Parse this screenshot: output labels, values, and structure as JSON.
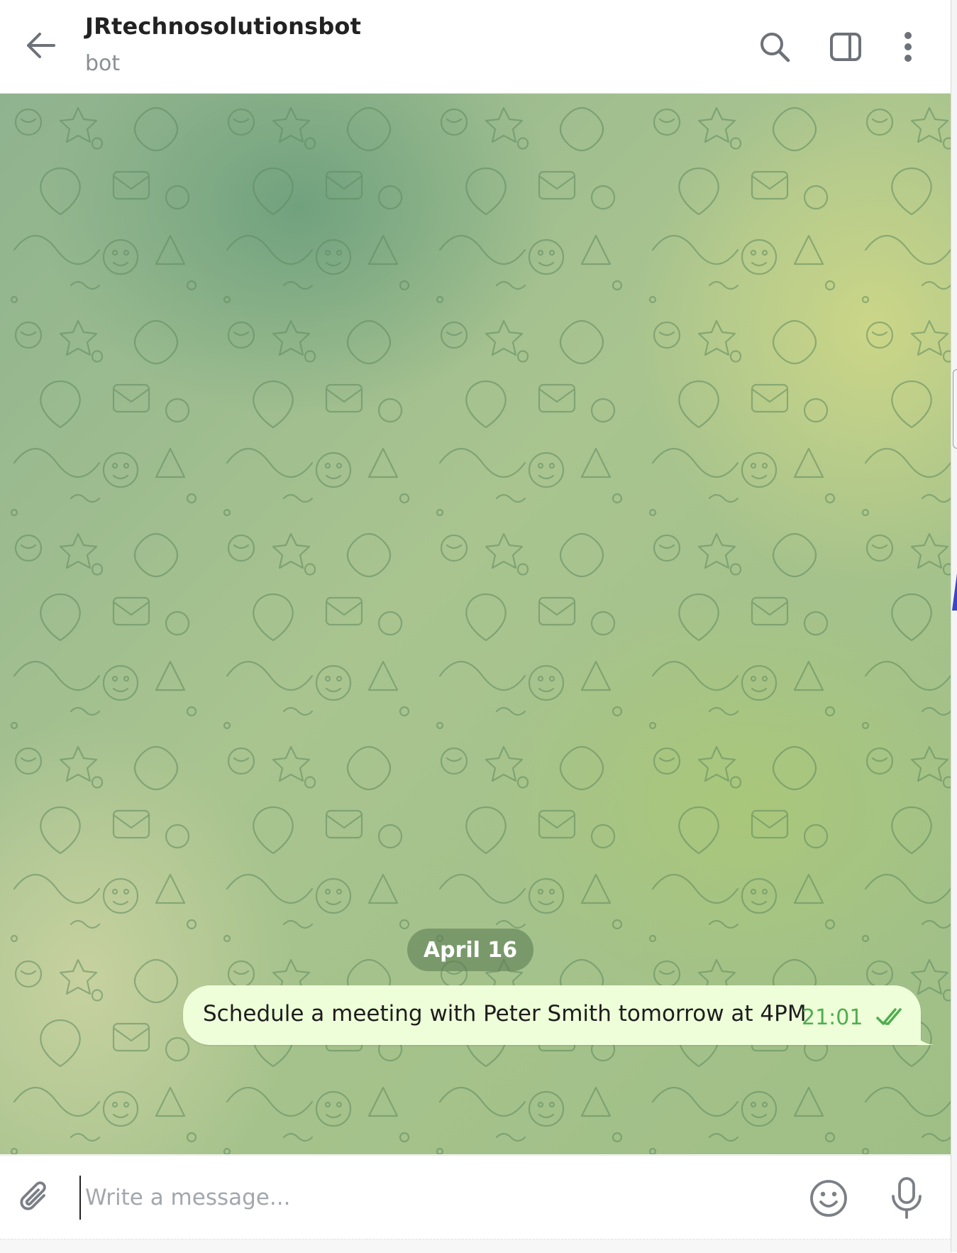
{
  "header": {
    "title": "JRtechnosolutionsbot",
    "subtitle": "bot",
    "icons": [
      "back-arrow-icon",
      "search-icon",
      "sidebar-toggle-icon",
      "more-vertical-icon"
    ]
  },
  "chat": {
    "date_label": "April 16",
    "messages": [
      {
        "direction": "outgoing",
        "text": "Schedule a meeting with Peter Smith tomorrow at 4PM",
        "time": "21:01",
        "status": "read-double-check"
      }
    ]
  },
  "composer": {
    "placeholder": "Write a message...",
    "value": "",
    "icons": [
      "paperclip-icon",
      "emoji-icon",
      "microphone-icon"
    ]
  },
  "colors": {
    "bubble_outgoing": "#eefed9",
    "time_and_check": "#4fae4e",
    "date_pill": "#6b8c63"
  }
}
